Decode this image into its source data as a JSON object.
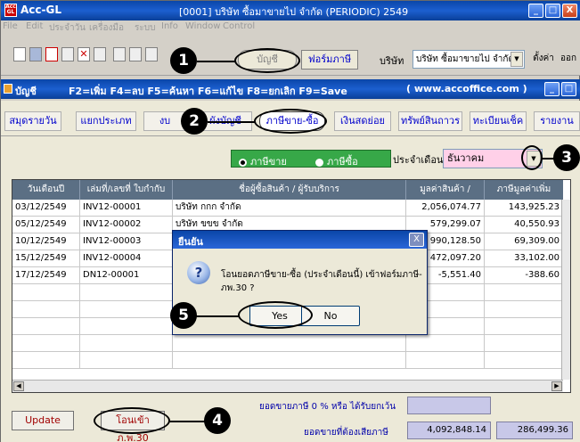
{
  "window": {
    "app_name": "Acc-GL",
    "title": "[0001]  บริษัท ซื้อมาขายไป จำกัด (PERIODIC)  2549",
    "icon_text": "Acc GL",
    "controls": [
      "_",
      "□",
      "X"
    ]
  },
  "menu": [
    "File",
    "Edit",
    "ประจำวัน",
    "เครื่องมือ",
    "ระบบ",
    "Info",
    "Window",
    "Control"
  ],
  "toolbar": {
    "account_label": "บัญชี",
    "tax_form_label": "ฟอร์มภาษี",
    "company_label": "บริษัท",
    "company_value": "บริษัท ซื้อมาขายไป จำกัด",
    "settings_label": "ตั้งค่า",
    "exit_label": "ออก"
  },
  "inner_window": {
    "title": "บัญชี",
    "shortcut_keys": "F2=เพิ่ม F4=ลบ F5=ค้นหา F6=แก้ไข F8=ยกเลิก F9=Save",
    "url": "( www.accoffice.com )"
  },
  "tabs": [
    "สมุดรายวัน",
    "แยกประเภท",
    "งบ",
    "ผังบัญชี",
    "ภาษีขาย-ซื้อ",
    "เงินสดย่อย",
    "ทรัพย์สินถาวร",
    "ทะเบียนเช็ค",
    "รายงาน"
  ],
  "filters": {
    "radio_sale": "ภาษีขาย",
    "radio_purchase": "ภาษีซื้อ",
    "month_label": "ประจำเดือน",
    "month_value": "ธันวาคม"
  },
  "table": {
    "headers": [
      "วันเดือนปี",
      "เล่มที่/เลขที่ ใบกำกับภาษี",
      "ชื่อผู้ซื้อสินค้า / ผู้รับบริการ",
      "มูลค่าสินค้า / บริการ",
      "ภาษีมูลค่าเพิ่ม"
    ],
    "rows": [
      [
        "03/12/2549",
        "INV12-00001",
        "บริษัท กกก จำกัด",
        "2,056,074.77",
        "143,925.23"
      ],
      [
        "05/12/2549",
        "INV12-00002",
        "บริษัท ขขข จำกัด",
        "579,299.07",
        "40,550.93"
      ],
      [
        "10/12/2549",
        "INV12-00003",
        "",
        "990,128.50",
        "69,309.00"
      ],
      [
        "15/12/2549",
        "INV12-00004",
        "",
        "472,097.20",
        "33,102.00"
      ],
      [
        "17/12/2549",
        "DN12-00001",
        "",
        "-5,551.40",
        "-388.60"
      ]
    ]
  },
  "footer": {
    "zero_rate_label": "ยอดขายภาษี 0 % หรือ ได้รับยกเว้น",
    "taxable_label": "ยอดขายที่ต้องเสียภาษี",
    "taxable_value": "4,092,848.14",
    "vat_total": "286,499.36",
    "update_label": "Update",
    "transfer_label": "โอนเข้า ภ.พ.30"
  },
  "dialog": {
    "title": "ยืนยัน",
    "message": "โอนยอดภาษีขาย-ซื้อ (ประจำเดือนนี้) เข้าฟอร์มภาษี-ภพ.30 ?",
    "yes_label": "Yes",
    "no_label": "No",
    "close": "X"
  },
  "callouts": [
    "1",
    "2",
    "3",
    "4",
    "5"
  ]
}
